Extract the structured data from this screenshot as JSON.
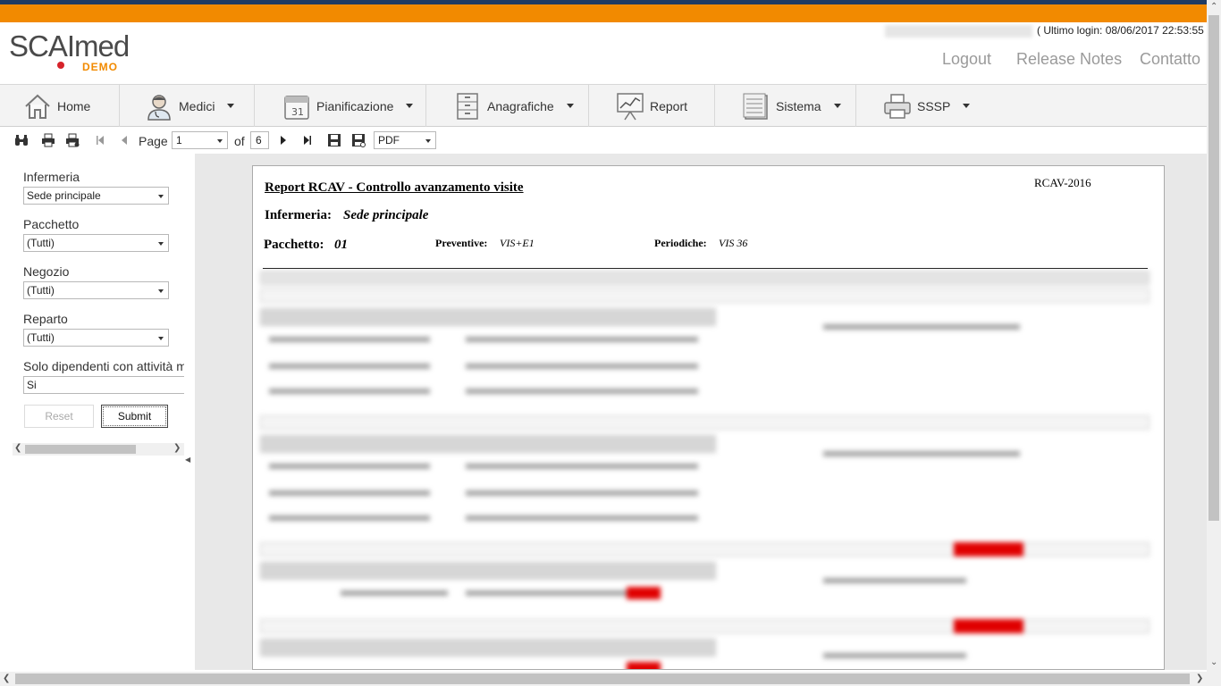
{
  "brand": {
    "logo_text": "SCAImed",
    "logo_tag": "DEMO"
  },
  "header": {
    "last_login": "( Ultimo login: 08/06/2017 22:53:55 )",
    "links": [
      "Logout",
      "Release Notes",
      "Contatto"
    ]
  },
  "nav": {
    "items": [
      {
        "label": "Home",
        "icon": "home-icon",
        "dropdown": false
      },
      {
        "label": "Medici",
        "icon": "doctor-icon",
        "dropdown": true
      },
      {
        "label": "Pianificazione",
        "icon": "calendar-icon",
        "dropdown": true,
        "calendar_day": "31"
      },
      {
        "label": "Anagrafiche",
        "icon": "cabinet-icon",
        "dropdown": true
      },
      {
        "label": "Report",
        "icon": "chart-board-icon",
        "dropdown": false
      },
      {
        "label": "Sistema",
        "icon": "server-icon",
        "dropdown": true
      },
      {
        "label": "SSSP",
        "icon": "printer-icon",
        "dropdown": true
      }
    ]
  },
  "toolbar": {
    "page_label": "Page",
    "page_value": "1",
    "of_label": "of",
    "total_pages": "6",
    "export_format": "PDF"
  },
  "filters": {
    "infermeria": {
      "label": "Infermeria",
      "value": "Sede principale"
    },
    "pacchetto": {
      "label": "Pacchetto",
      "value": "(Tutti)"
    },
    "negozio": {
      "label": "Negozio",
      "value": "(Tutti)"
    },
    "reparto": {
      "label": "Reparto",
      "value": "(Tutti)"
    },
    "solo_dipendenti": {
      "label": "Solo dipendenti con attività m",
      "value": "Si"
    },
    "reset_label": "Reset",
    "submit_label": "Submit"
  },
  "report": {
    "title": "Report RCAV - Controllo avanzamento visite",
    "code": "RCAV-2016",
    "infermeria_label": "Infermeria:",
    "infermeria_value": "Sede principale",
    "pacchetto_label": "Pacchetto:",
    "pacchetto_value": "01",
    "preventive_label": "Preventive:",
    "preventive_value": "VIS+E1",
    "periodiche_label": "Periodiche:",
    "periodiche_value": "VIS 36"
  },
  "colors": {
    "accent_orange": "#f28a00",
    "top_navy": "#1f3b63",
    "alert_red": "#e00000"
  }
}
